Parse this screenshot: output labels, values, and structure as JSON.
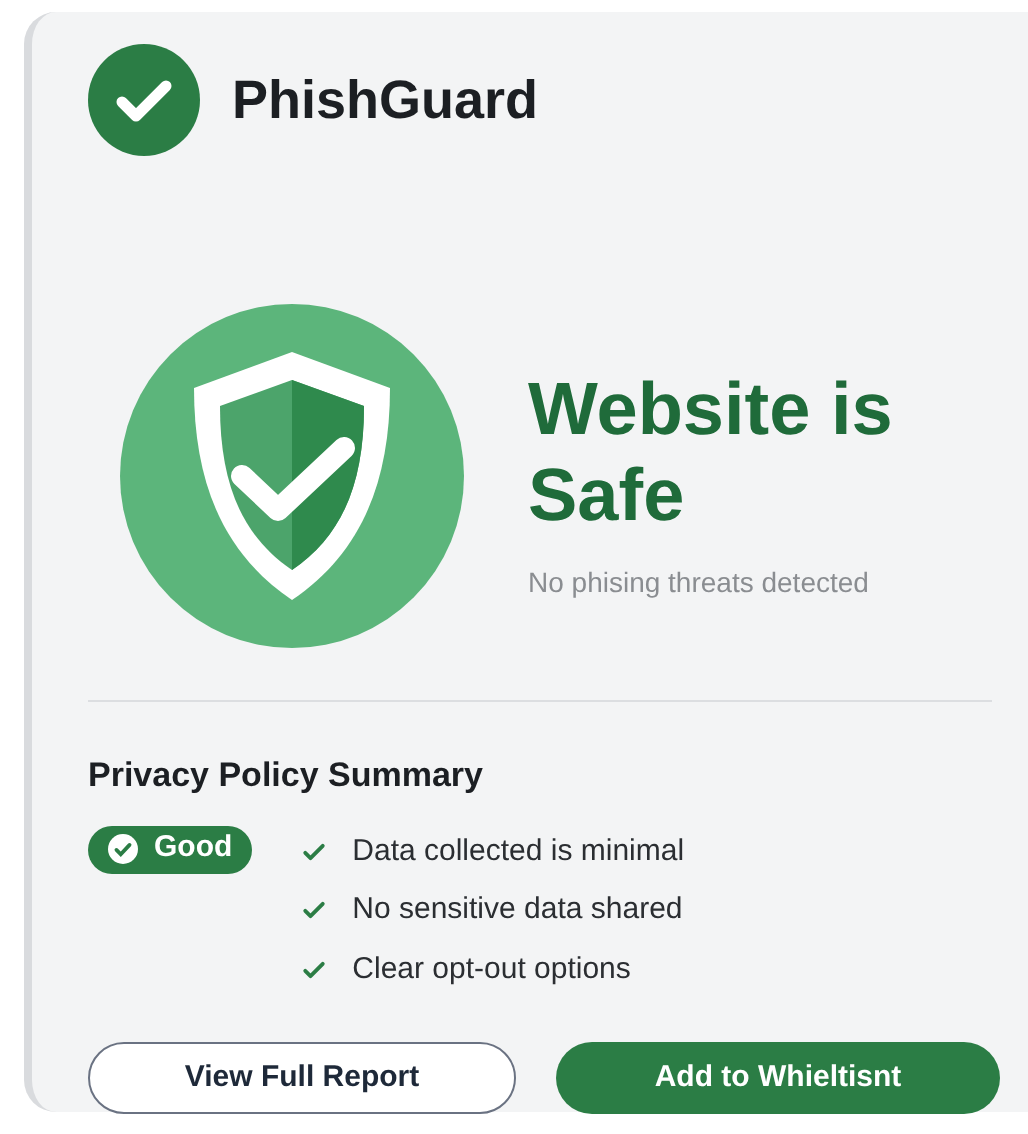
{
  "app": {
    "title": "PhishGuard"
  },
  "status": {
    "heading": "Website is Safe",
    "subtitle": "No phising threats detected"
  },
  "privacy": {
    "title": "Privacy Policy Summary",
    "badge": "Good",
    "points": [
      "Data collected is minimal",
      "No sensitive data shared",
      "Clear opt-out options"
    ]
  },
  "buttons": [
    {
      "label": "View Full Report",
      "kind": "outline"
    },
    {
      "label": "Add to Whieltisnt",
      "kind": "primary"
    }
  ]
}
